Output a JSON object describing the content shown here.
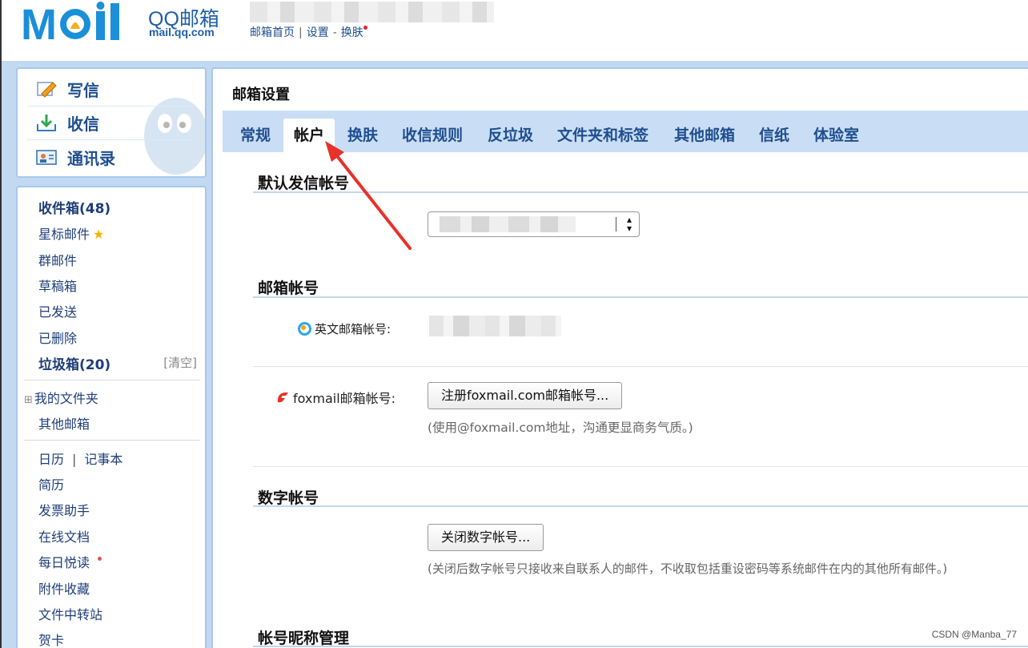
{
  "header": {
    "logo_text": "MOil",
    "brand": "QQ邮箱",
    "brand_url": "mail.qq.com",
    "nav": [
      "邮箱首页",
      "设置",
      "换肤"
    ]
  },
  "left": {
    "commands": [
      {
        "label": "写信",
        "icon": "pencil-icon"
      },
      {
        "label": "收信",
        "icon": "inbox-download-icon"
      },
      {
        "label": "通讯录",
        "icon": "contacts-icon"
      }
    ],
    "folders": {
      "inbox": "收件箱(48)",
      "starred": "星标邮件",
      "group": "群邮件",
      "drafts": "草稿箱",
      "sent": "已发送",
      "deleted": "已删除",
      "spam": "垃圾箱(20)",
      "spam_clear": "[清空]",
      "my_folders": "我的文件夹",
      "my_folders_toggle": "⊞",
      "other_mail": "其他邮箱"
    },
    "tools": {
      "calendar": "日历",
      "tool_sep": "|",
      "notes": "记事本",
      "resume": "简历",
      "invoice": "发票助手",
      "docs": "在线文档",
      "daily": "每日悦读",
      "attachments": "附件收藏",
      "transfer": "文件中转站",
      "cards": "贺卡"
    }
  },
  "main": {
    "title": "邮箱设置",
    "tabs": [
      "常规",
      "帐户",
      "换肤",
      "收信规则",
      "反垃圾",
      "文件夹和标签",
      "其他邮箱",
      "信纸",
      "体验室"
    ],
    "active_tab": "帐户",
    "default_sender": {
      "title": "默认发信帐号"
    },
    "mailbox_account": {
      "title": "邮箱帐号",
      "english_label": "英文邮箱帐号:",
      "foxmail_label": "foxmail邮箱帐号:",
      "foxmail_button": "注册foxmail.com邮箱帐号...",
      "foxmail_hint": "(使用@foxmail.com地址，沟通更显商务气质。)"
    },
    "digital_account": {
      "title": "数字帐号",
      "button": "关闭数字帐号...",
      "hint": "(关闭后数字帐号只接收来自联系人的邮件，不收取包括重设密码等系统邮件在内的其他所有邮件。)"
    },
    "nickname": {
      "title": "帐号昵称管理"
    }
  },
  "watermark": "CSDN @Manba_77",
  "colors": {
    "accent_blue": "#1f4e8f",
    "frame_blue": "#c2d9f2",
    "annotation_red": "#e8312a"
  }
}
